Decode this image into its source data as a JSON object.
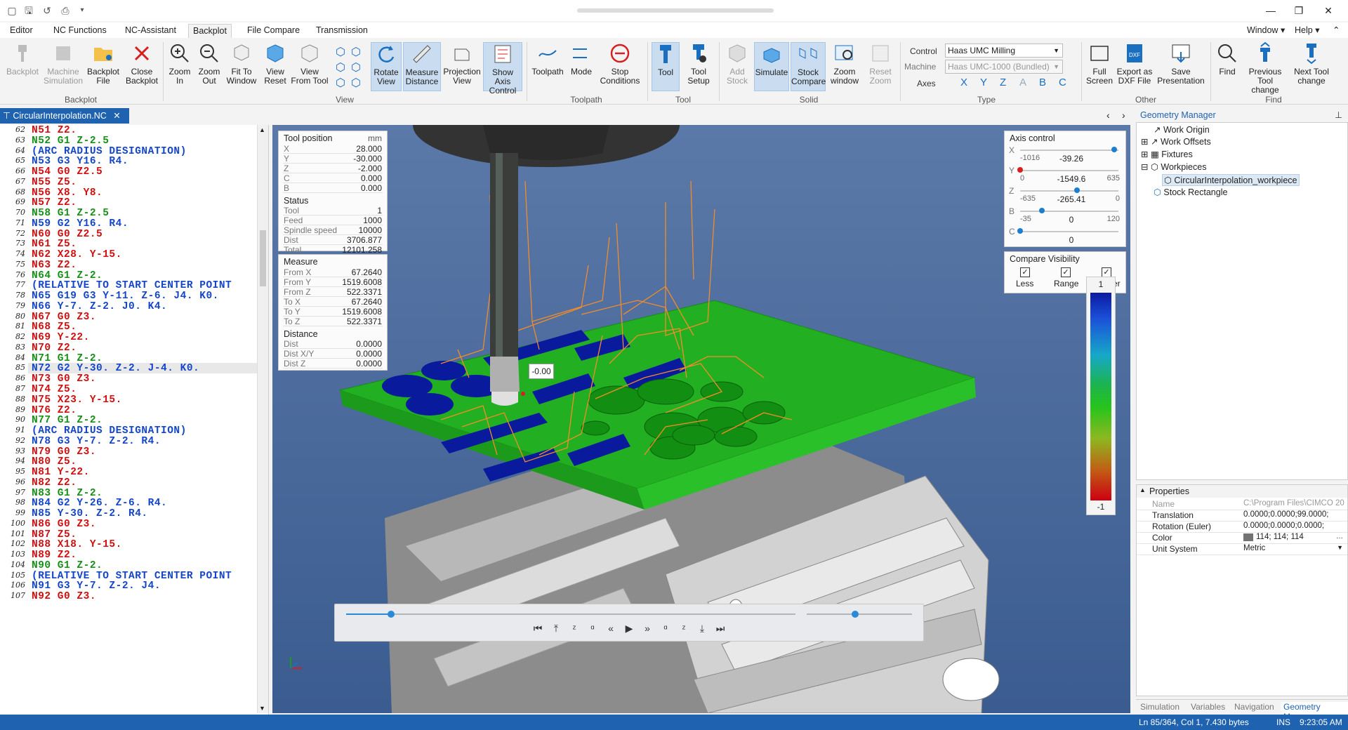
{
  "titlebar": {
    "window_menu": "Window",
    "help_menu": "Help"
  },
  "menu_tabs": [
    "Editor",
    "NC Functions",
    "NC-Assistant",
    "Backplot",
    "File Compare",
    "Transmission"
  ],
  "ribbon": {
    "buttons": [
      "Backplot",
      "Machine Simulation",
      "Backplot File",
      "Close Backplot",
      "Zoom In",
      "Zoom Out",
      "Fit To Window",
      "View Reset",
      "View From Tool",
      "Rotate View",
      "Measure Distance",
      "Projection View",
      "Show Axis Control",
      "Toolpath",
      "Mode",
      "Stop Conditions",
      "Tool",
      "Tool Setup",
      "Add Stock",
      "Simulate",
      "Stock Compare",
      "Zoom window",
      "Reset Zoom",
      "Full Screen",
      "Export as DXF File",
      "Save Presentation",
      "Find",
      "Previous Tool change",
      "Next Tool change"
    ],
    "groups": [
      "Backplot",
      "View",
      "Toolpath",
      "Tool",
      "Solid",
      "Type",
      "Other",
      "Find"
    ],
    "control_label": "Control",
    "control_value": "Haas UMC Milling",
    "machine_label": "Machine",
    "machine_value": "Haas UMC-1000 (Bundled)",
    "axes_label": "Axes",
    "axes": [
      "X",
      "Y",
      "Z",
      "A",
      "B",
      "C"
    ]
  },
  "editor": {
    "filename": "CircularInterpolation.NC",
    "lines": [
      {
        "n": "62",
        "t": "N51 Z2.",
        "c": "red"
      },
      {
        "n": "63",
        "t": "N52 G1 Z-2.5",
        "c": "green"
      },
      {
        "n": "64",
        "t": "(ARC RADIUS DESIGNATION)",
        "c": "blue"
      },
      {
        "n": "65",
        "t": "N53 G3 Y16. R4.",
        "c": "blue"
      },
      {
        "n": "66",
        "t": "N54 G0 Z2.5",
        "c": "red"
      },
      {
        "n": "67",
        "t": "N55 Z5.",
        "c": "red"
      },
      {
        "n": "68",
        "t": "N56 X8. Y8.",
        "c": "red"
      },
      {
        "n": "69",
        "t": "N57 Z2.",
        "c": "red"
      },
      {
        "n": "70",
        "t": "N58 G1 Z-2.5",
        "c": "green"
      },
      {
        "n": "71",
        "t": "N59 G2 Y16. R4.",
        "c": "blue"
      },
      {
        "n": "72",
        "t": "N60 G0 Z2.5",
        "c": "red"
      },
      {
        "n": "73",
        "t": "N61 Z5.",
        "c": "red"
      },
      {
        "n": "74",
        "t": "N62 X28. Y-15.",
        "c": "red"
      },
      {
        "n": "75",
        "t": "N63 Z2.",
        "c": "red"
      },
      {
        "n": "76",
        "t": "N64 G1 Z-2.",
        "c": "green"
      },
      {
        "n": "77",
        "t": "(RELATIVE TO START CENTER POINT",
        "c": "blue"
      },
      {
        "n": "78",
        "t": "N65 G19 G3 Y-11. Z-6. J4. K0.",
        "c": "blue"
      },
      {
        "n": "79",
        "t": "N66 Y-7. Z-2. J0. K4.",
        "c": "blue"
      },
      {
        "n": "80",
        "t": "N67 G0 Z3.",
        "c": "red"
      },
      {
        "n": "81",
        "t": "N68 Z5.",
        "c": "red"
      },
      {
        "n": "82",
        "t": "N69 Y-22.",
        "c": "red"
      },
      {
        "n": "83",
        "t": "N70 Z2.",
        "c": "red"
      },
      {
        "n": "84",
        "t": "N71 G1 Z-2.",
        "c": "green"
      },
      {
        "n": "85",
        "t": "N72 G2 Y-30. Z-2. J-4. K0.",
        "c": "blue"
      },
      {
        "n": "86",
        "t": "N73 G0 Z3.",
        "c": "red"
      },
      {
        "n": "87",
        "t": "N74 Z5.",
        "c": "red"
      },
      {
        "n": "88",
        "t": "N75 X23. Y-15.",
        "c": "red"
      },
      {
        "n": "89",
        "t": "N76 Z2.",
        "c": "red"
      },
      {
        "n": "90",
        "t": "N77 G1 Z-2.",
        "c": "green"
      },
      {
        "n": "91",
        "t": "(ARC RADIUS DESIGNATION)",
        "c": "blue"
      },
      {
        "n": "92",
        "t": "N78 G3 Y-7. Z-2. R4.",
        "c": "blue"
      },
      {
        "n": "93",
        "t": "N79 G0 Z3.",
        "c": "red"
      },
      {
        "n": "94",
        "t": "N80 Z5.",
        "c": "red"
      },
      {
        "n": "95",
        "t": "N81 Y-22.",
        "c": "red"
      },
      {
        "n": "96",
        "t": "N82 Z2.",
        "c": "red"
      },
      {
        "n": "97",
        "t": "N83 G1 Z-2.",
        "c": "green"
      },
      {
        "n": "98",
        "t": "N84 G2 Y-26. Z-6. R4.",
        "c": "blue"
      },
      {
        "n": "99",
        "t": "N85 Y-30. Z-2. R4.",
        "c": "blue"
      },
      {
        "n": "100",
        "t": "N86 G0 Z3.",
        "c": "red"
      },
      {
        "n": "101",
        "t": "N87 Z5.",
        "c": "red"
      },
      {
        "n": "102",
        "t": "N88 X18. Y-15.",
        "c": "red"
      },
      {
        "n": "103",
        "t": "N89 Z2.",
        "c": "red"
      },
      {
        "n": "104",
        "t": "N90 G1 Z-2.",
        "c": "green"
      },
      {
        "n": "105",
        "t": "(RELATIVE TO START CENTER POINT",
        "c": "blue"
      },
      {
        "n": "106",
        "t": "N91 G3 Y-7. Z-2. J4.",
        "c": "blue"
      },
      {
        "n": "107",
        "t": "N92 G0 Z3.",
        "c": "red"
      }
    ]
  },
  "tool_position": {
    "title": "Tool position",
    "unit": "mm",
    "rows": [
      [
        "X",
        "28.000"
      ],
      [
        "Y",
        "-30.000"
      ],
      [
        "Z",
        "-2.000"
      ],
      [
        "C",
        "0.000"
      ],
      [
        "B",
        "0.000"
      ]
    ]
  },
  "status": {
    "title": "Status",
    "rows": [
      [
        "Tool",
        "1"
      ],
      [
        "Feed",
        "1000"
      ],
      [
        "Spindle speed",
        "10000"
      ],
      [
        "Dist",
        "3706.877"
      ],
      [
        "Total",
        "12101.258"
      ]
    ]
  },
  "measure": {
    "title": "Measure",
    "rows": [
      [
        "From X",
        "67.2640"
      ],
      [
        "From Y",
        "1519.6008"
      ],
      [
        "From Z",
        "522.3371"
      ],
      [
        "To X",
        "67.2640"
      ],
      [
        "To Y",
        "1519.6008"
      ],
      [
        "To Z",
        "522.3371"
      ]
    ]
  },
  "distance": {
    "title": "Distance",
    "rows": [
      [
        "Dist",
        "0.0000"
      ],
      [
        "Dist X/Y",
        "0.0000"
      ],
      [
        "Dist Z",
        "0.0000"
      ]
    ]
  },
  "axis_control": {
    "title": "Axis control",
    "axes": [
      {
        "name": "X",
        "min": "-1016",
        "val": "-39.26",
        "max": "",
        "level": 0.96,
        "color": "#1a7fd0"
      },
      {
        "name": "Y",
        "min": "0",
        "val": "-1549.6",
        "max": "635",
        "level": 0.0,
        "color": "#d62020"
      },
      {
        "name": "Z",
        "min": "-635",
        "val": "-265.41",
        "max": "0",
        "level": 0.58,
        "color": "#1a7fd0"
      },
      {
        "name": "B",
        "min": "-35",
        "val": "0",
        "max": "120",
        "level": 0.22,
        "color": "#1a7fd0"
      },
      {
        "name": "C",
        "min": "",
        "val": "0",
        "max": "",
        "level": 0.0,
        "color": "#1a7fd0"
      }
    ]
  },
  "compare_visibility": {
    "title": "Compare Visibility",
    "items": [
      "Less",
      "Range",
      "Greater"
    ]
  },
  "color_scale": {
    "top": "1",
    "bottom": "-1"
  },
  "measure_label": "-0.00",
  "geometry_manager": {
    "title": "Geometry Manager",
    "items": [
      {
        "label": "Work Origin",
        "level": 0
      },
      {
        "label": "Work Offsets",
        "level": 0
      },
      {
        "label": "Fixtures",
        "level": 0
      },
      {
        "label": "Workpieces",
        "level": 0
      },
      {
        "label": "CircularInterpolation_workpiece",
        "level": 1
      },
      {
        "label": "Stock Rectangle",
        "level": 0
      }
    ]
  },
  "properties": {
    "title": "Properties",
    "rows": [
      [
        "Name",
        "C:\\Program Files\\CIMCO 20"
      ],
      [
        "Translation",
        "0.0000;0.0000;99.0000;"
      ],
      [
        "Rotation (Euler)",
        "0.0000;0.0000;0.0000;"
      ],
      [
        "Color",
        "114; 114; 114"
      ],
      [
        "Unit System",
        "Metric"
      ]
    ],
    "color_swatch": "#727272"
  },
  "bottom_tabs": [
    "Simulation",
    "Variables",
    "Navigation",
    "Geometry Man..."
  ],
  "statusbar": {
    "pos": "Ln 85/364, Col 1, 7.430 bytes",
    "mode": "INS",
    "time": "9:23:05 AM"
  },
  "playback": {
    "progress": 0.1,
    "speed": 0.46,
    "controls": [
      "first",
      "prev-tool",
      "prev-block-z",
      "prev-move",
      "prev-step",
      "play",
      "next-step",
      "next-move",
      "next-block-z",
      "next-tool",
      "last"
    ]
  }
}
